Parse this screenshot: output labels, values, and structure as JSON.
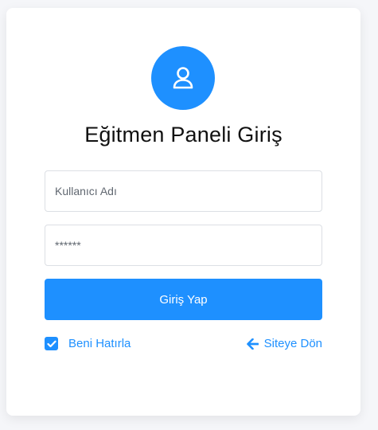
{
  "form": {
    "title": "Eğitmen Paneli Giriş",
    "username_placeholder": "Kullanıcı Adı",
    "password_placeholder": "******",
    "submit_label": "Giriş Yap",
    "remember_label": "Beni Hatırla",
    "remember_checked": true,
    "back_label": "Siteye Dön"
  },
  "icons": {
    "avatar": "user-icon",
    "checkbox": "checkmark-icon",
    "back": "arrow-left-icon"
  },
  "colors": {
    "accent": "#1e90ff",
    "card_background": "#ffffff",
    "page_background": "#f5f6f9"
  }
}
